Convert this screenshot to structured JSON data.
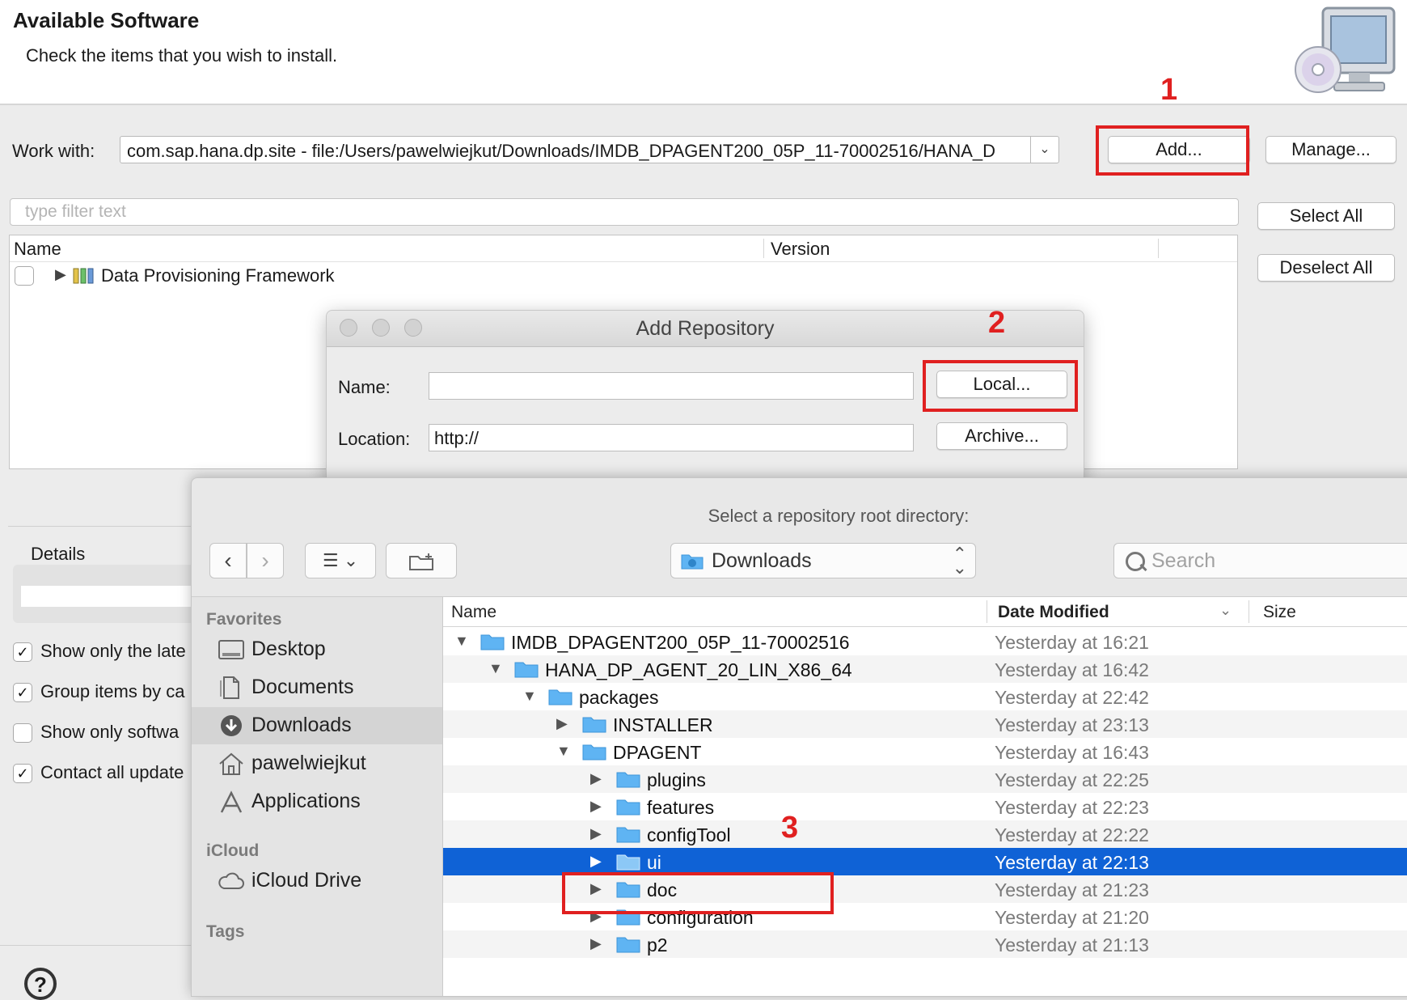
{
  "header": {
    "title": "Available Software",
    "subtitle": "Check the items that you wish to install."
  },
  "work_with": {
    "label": "Work with:",
    "value": "com.sap.hana.dp.site - file:/Users/pawelwiejkut/Downloads/IMDB_DPAGENT200_05P_11-70002516/HANA_D",
    "add_label": "Add...",
    "manage_label": "Manage..."
  },
  "filter": {
    "placeholder": "type filter text"
  },
  "buttons": {
    "select_all": "Select All",
    "deselect_all": "Deselect All"
  },
  "table": {
    "columns": [
      "Name",
      "Version"
    ],
    "rows": [
      {
        "label": "Data Provisioning Framework"
      }
    ]
  },
  "details": {
    "label": "Details"
  },
  "options": [
    {
      "label": "Show only the late",
      "checked": true
    },
    {
      "label": "Group items by ca",
      "checked": true
    },
    {
      "label": "Show only softwa",
      "checked": false
    },
    {
      "label": "Contact all update",
      "checked": true
    }
  ],
  "help": {
    "glyph": "?"
  },
  "annotations": {
    "one": "1",
    "two": "2",
    "three": "3",
    "color": "#e02020"
  },
  "repo_dialog": {
    "title": "Add Repository",
    "name_label": "Name:",
    "name_value": "",
    "location_label": "Location:",
    "location_value": "http://",
    "local_label": "Local...",
    "archive_label": "Archive..."
  },
  "chooser": {
    "prompt": "Select a repository root directory:",
    "location": "Downloads",
    "search_placeholder": "Search",
    "view_glyph": "☰ ⌄",
    "sidebar": {
      "favorites_heading": "Favorites",
      "favorites": [
        {
          "label": "Desktop",
          "icon": "desktop-icon"
        },
        {
          "label": "Documents",
          "icon": "documents-icon"
        },
        {
          "label": "Downloads",
          "icon": "downloads-icon",
          "selected": true
        },
        {
          "label": "pawelwiejkut",
          "icon": "home-icon"
        },
        {
          "label": "Applications",
          "icon": "applications-icon"
        }
      ],
      "icloud_heading": "iCloud",
      "icloud": [
        {
          "label": "iCloud Drive",
          "icon": "cloud-icon"
        }
      ],
      "tags_heading": "Tags"
    },
    "columns": {
      "name": "Name",
      "date": "Date Modified",
      "size": "Size"
    },
    "accent": "#0f62d6",
    "rows": [
      {
        "name": "IMDB_DPAGENT200_05P_11-70002516",
        "date": "Yesterday at 16:21",
        "depth": 0,
        "expanded": true
      },
      {
        "name": "HANA_DP_AGENT_20_LIN_X86_64",
        "date": "Yesterday at 16:42",
        "depth": 1,
        "expanded": true
      },
      {
        "name": "packages",
        "date": "Yesterday at 22:42",
        "depth": 2,
        "expanded": true
      },
      {
        "name": "INSTALLER",
        "date": "Yesterday at 23:13",
        "depth": 3,
        "expanded": false
      },
      {
        "name": "DPAGENT",
        "date": "Yesterday at 16:43",
        "depth": 3,
        "expanded": true
      },
      {
        "name": "plugins",
        "date": "Yesterday at 22:25",
        "depth": 4,
        "expanded": false
      },
      {
        "name": "features",
        "date": "Yesterday at 22:23",
        "depth": 4,
        "expanded": false
      },
      {
        "name": "configTool",
        "date": "Yesterday at 22:22",
        "depth": 4,
        "expanded": false
      },
      {
        "name": "ui",
        "date": "Yesterday at 22:13",
        "depth": 4,
        "expanded": false,
        "selected": true
      },
      {
        "name": "doc",
        "date": "Yesterday at 21:23",
        "depth": 4,
        "expanded": false
      },
      {
        "name": "configuration",
        "date": "Yesterday at 21:20",
        "depth": 4,
        "expanded": false
      },
      {
        "name": "p2",
        "date": "Yesterday at 21:13",
        "depth": 4,
        "expanded": false
      }
    ]
  }
}
